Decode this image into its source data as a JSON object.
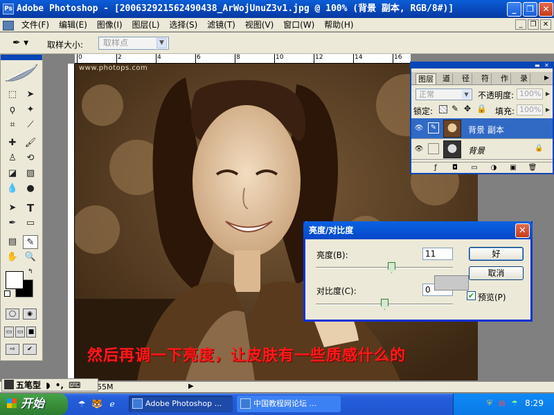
{
  "window": {
    "title": "Adobe Photoshop - [200632921562490438_ArWojUnuZ3v1.jpg @ 100% (背景 副本, RGB/8#)]",
    "app_icon": "photoshop-icon",
    "controls": [
      "_",
      "❐",
      "✕"
    ],
    "doc_controls": [
      "_",
      "❐",
      "✕"
    ]
  },
  "menu": {
    "items": [
      "文件(F)",
      "编辑(E)",
      "图像(I)",
      "图层(L)",
      "选择(S)",
      "滤镜(T)",
      "视图(V)",
      "窗口(W)",
      "帮助(H)"
    ]
  },
  "options": {
    "sample_label": "取样大小:",
    "sample_value": "取样点"
  },
  "ruler": {
    "labels": [
      "0",
      "2",
      "4",
      "6",
      "8",
      "10",
      "12",
      "14",
      "16",
      "18",
      "20",
      "22"
    ]
  },
  "canvas": {
    "watermark": "www.photops.com",
    "caption": "然后再调一下亮度，让皮肤有一些质感什么的"
  },
  "layers_panel": {
    "tabs": [
      "图层",
      "通道",
      "路径",
      "历史记录",
      "动作",
      "导航器"
    ],
    "tab_short": [
      "图层",
      "道",
      "径",
      "符",
      "作",
      "录"
    ],
    "blend_mode": "正常",
    "opacity_label": "不透明度:",
    "opacity_value": "100%",
    "lock_label": "锁定:",
    "fill_label": "填充:",
    "fill_value": "100%",
    "layers": [
      {
        "name": "背景 副本",
        "selected": true
      },
      {
        "name": "背景",
        "selected": false,
        "locked": true
      }
    ]
  },
  "dialog": {
    "title": "亮度/对比度",
    "brightness_label": "亮度(B):",
    "brightness_value": "11",
    "contrast_label": "对比度(C):",
    "contrast_value": "0",
    "ok_label": "好",
    "cancel_label": "取消",
    "preview_label": "预览(P)",
    "preview_checked": true
  },
  "statusbar": {
    "ime_label": "五笔型",
    "text": "55M"
  },
  "taskbar": {
    "start_label": "开始",
    "tasks": [
      {
        "label": "Adobe Photoshop ...",
        "active": true
      },
      {
        "label": "中国教程网论坛 ...",
        "active": false
      }
    ],
    "clock": "8:29"
  },
  "colors": {
    "title_blue": "#0846b8",
    "caption_red": "#ff1a1a",
    "selected_layer": "#316ac5",
    "photo_tone": "#8a6a48"
  }
}
